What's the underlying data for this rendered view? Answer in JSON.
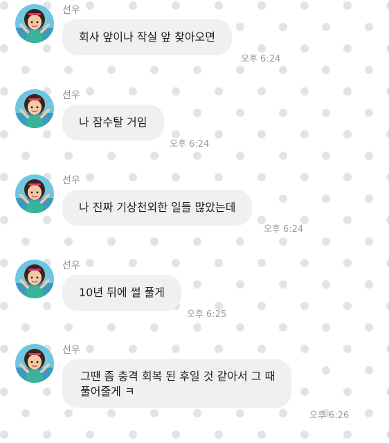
{
  "chat": {
    "messages": [
      {
        "sender": "선우",
        "text": "회사 앞이나 작실 앞 찾아오면",
        "time": "오후 6:24"
      },
      {
        "sender": "선우",
        "text": "나 잠수탈 거임",
        "time": "오후 6:24"
      },
      {
        "sender": "선우",
        "text": "나 진짜 기상천외한 일들 많았는데",
        "time": "오후 6:24"
      },
      {
        "sender": "선우",
        "text": "10년 뒤에 썰 풀게",
        "time": "오후 6:25"
      },
      {
        "sender": "선우",
        "text": "그땐 좀 충격 회복 된 후일 것 같아서 그 때\n풀어줄게  ㅋ",
        "time": "오후 6:26"
      }
    ]
  }
}
